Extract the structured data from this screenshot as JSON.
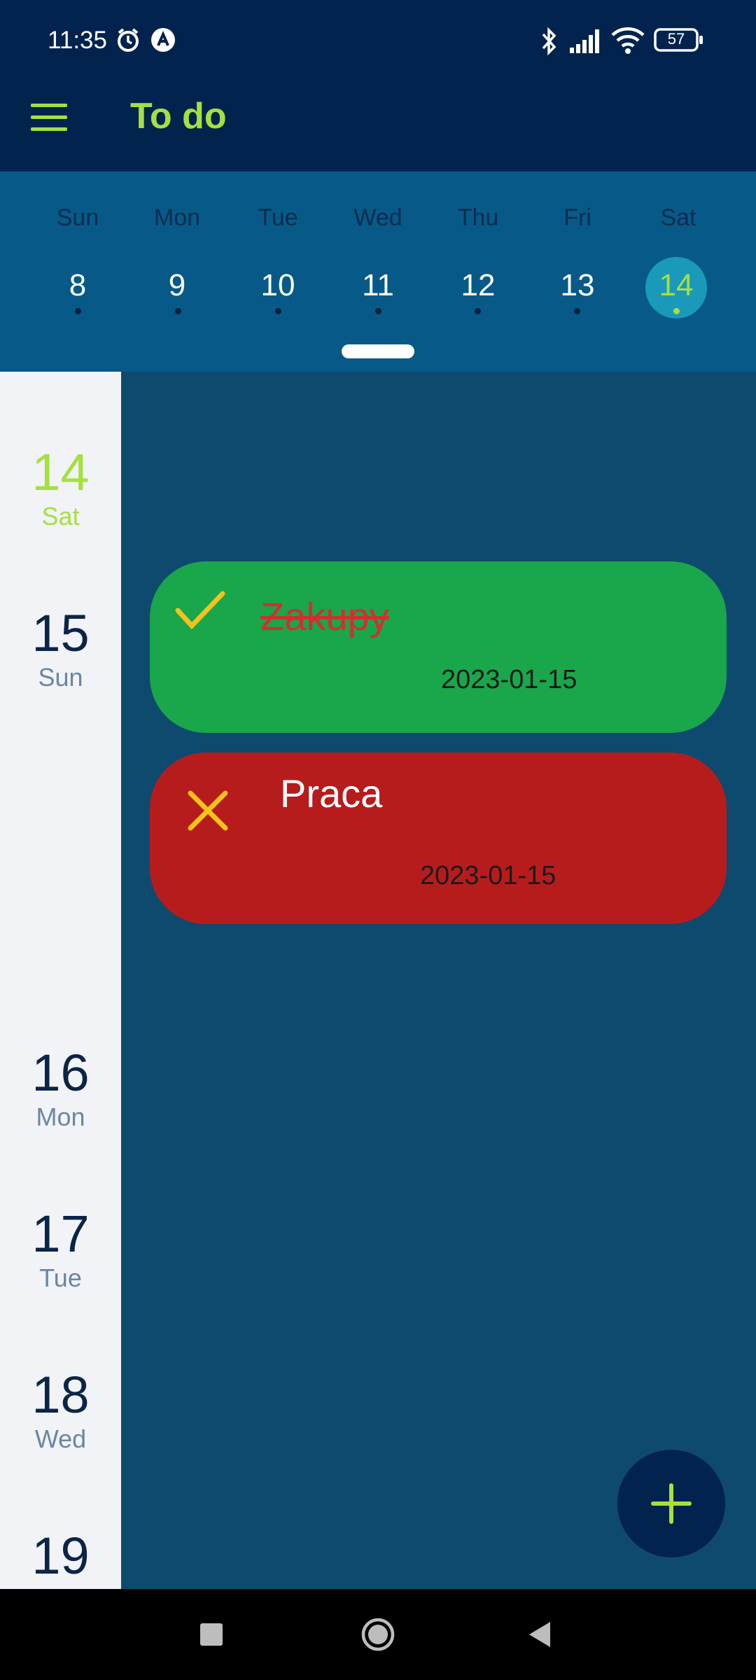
{
  "status_bar": {
    "time": "11:35",
    "battery": "57"
  },
  "app_bar": {
    "title": "To do",
    "menu_icon": "hamburger-menu-icon"
  },
  "week": {
    "days": [
      {
        "name": "Sun",
        "num": "8"
      },
      {
        "name": "Mon",
        "num": "9"
      },
      {
        "name": "Tue",
        "num": "10"
      },
      {
        "name": "Wed",
        "num": "11"
      },
      {
        "name": "Thu",
        "num": "12"
      },
      {
        "name": "Fri",
        "num": "13"
      },
      {
        "name": "Sat",
        "num": "14"
      }
    ],
    "selected_index": 6
  },
  "rail": {
    "days": [
      {
        "num": "14",
        "name": "Sat"
      },
      {
        "num": "15",
        "name": "Sun"
      },
      {
        "num": "16",
        "name": "Mon"
      },
      {
        "num": "17",
        "name": "Tue"
      },
      {
        "num": "18",
        "name": "Wed"
      },
      {
        "num": "19",
        "name": ""
      }
    ]
  },
  "tasks": [
    {
      "title": "Zakupy",
      "date": "2023-01-15",
      "done": true,
      "color": "#1aa64b",
      "icon": "checkmark-icon"
    },
    {
      "title": "Praca",
      "date": "2023-01-15",
      "done": false,
      "color": "#b71c1c",
      "icon": "close-icon"
    }
  ],
  "colors": {
    "accent": "#a5e041",
    "icon_yellow": "#f4c21a",
    "strike_red": "#d32f2f"
  },
  "fab": {
    "icon": "plus-icon"
  }
}
